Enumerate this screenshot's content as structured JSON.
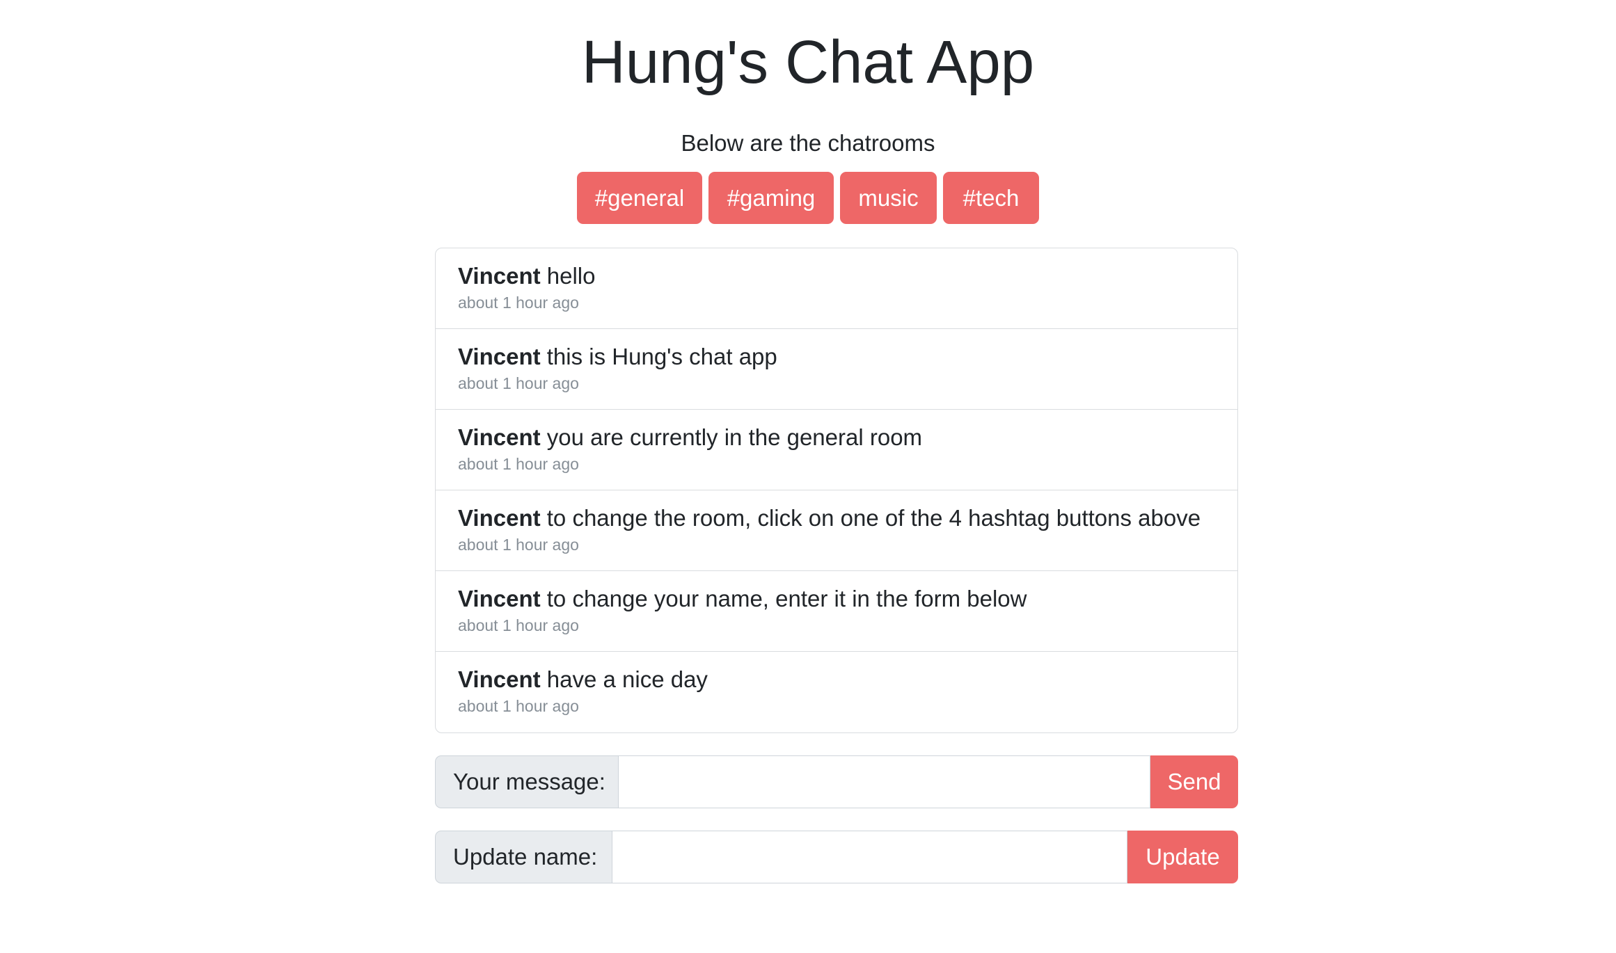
{
  "header": {
    "title": "Hung's Chat App",
    "subtitle": "Below are the chatrooms"
  },
  "rooms": [
    {
      "label": "#general"
    },
    {
      "label": "#gaming"
    },
    {
      "label": "music"
    },
    {
      "label": "#tech"
    }
  ],
  "messages": [
    {
      "user": "Vincent",
      "text": "hello",
      "time": "about 1 hour ago"
    },
    {
      "user": "Vincent",
      "text": "this is Hung's chat app",
      "time": "about 1 hour ago"
    },
    {
      "user": "Vincent",
      "text": "you are currently in the general room",
      "time": "about 1 hour ago"
    },
    {
      "user": "Vincent",
      "text": "to change the room, click on one of the 4 hashtag buttons above",
      "time": "about 1 hour ago"
    },
    {
      "user": "Vincent",
      "text": "to change your name, enter it in the form below",
      "time": "about 1 hour ago"
    },
    {
      "user": "Vincent",
      "text": "have a nice day",
      "time": "about 1 hour ago"
    }
  ],
  "message_form": {
    "label": "Your message:",
    "value": "",
    "button_label": "Send"
  },
  "name_form": {
    "label": "Update name:",
    "value": "",
    "button_label": "Update"
  },
  "colors": {
    "accent": "#ee6767",
    "label_bg": "#e9ecef",
    "border": "#d9dcdf",
    "muted_text": "#868e96"
  }
}
